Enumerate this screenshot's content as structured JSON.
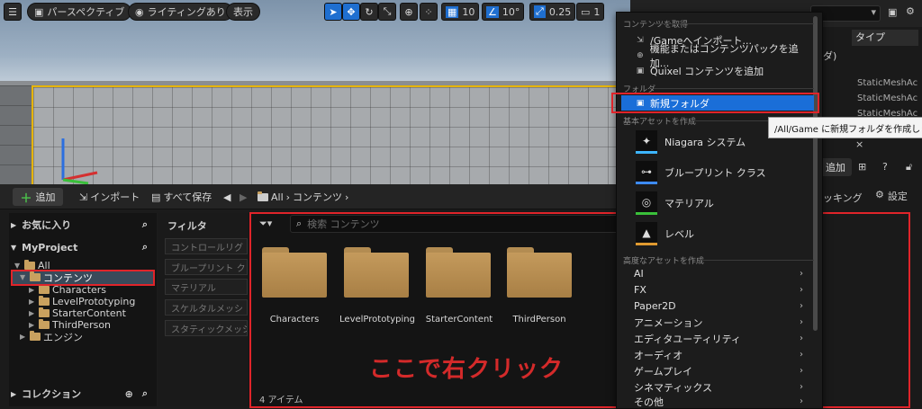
{
  "viewport": {
    "perspective_label": "パースペクティブ",
    "lighting_label": "ライティングあり",
    "show_label": "表示",
    "grid_value": "10",
    "angle_value": "10°",
    "scale_value": "0.25",
    "camera_value": "1"
  },
  "content_browser": {
    "add_label": "追加",
    "import_label": "インポート",
    "save_all_label": "すべて保存",
    "breadcrumb_all": "All",
    "breadcrumb_content": "コンテンツ",
    "favorites_label": "お気に入り",
    "project_label": "MyProject",
    "tree": {
      "all": "All",
      "content": "コンテンツ",
      "characters": "Characters",
      "level_prototyping": "LevelPrototyping",
      "starter_content": "StarterContent",
      "third_person": "ThirdPerson",
      "engine": "エンジン"
    },
    "collections_label": "コレクション",
    "filter_label": "フィルタ",
    "filters": [
      "コントロールリグ",
      "ブループリント ク",
      "マテリアル",
      "スケルタルメッシ",
      "スタティックメッシ"
    ],
    "search_placeholder": "検索 コンテンツ",
    "folders": [
      "Characters",
      "LevelPrototyping",
      "StarterContent",
      "ThirdPerson"
    ],
    "item_count": "4 アイテム",
    "annotation": "ここで右クリック"
  },
  "context_menu": {
    "get_content_header": "コンテンツを取得",
    "import_to_game": "/Gameへインポート...",
    "add_feature_pack": "機能またはコンテンツパックを追加...",
    "add_quixel": "Quixel コンテンツを追加",
    "folder_header": "フォルダ",
    "new_folder": "新規フォルダ",
    "basic_assets_header": "基本アセットを作成",
    "niagara_system": "Niagara システム",
    "blueprint_class": "ブループリント クラス",
    "material": "マテリアル",
    "level": "レベル",
    "advanced_assets_header": "高度なアセットを作成",
    "advanced_items": [
      "AI",
      "FX",
      "Paper2D",
      "アニメーション",
      "エディタユーティリティ",
      "オーディオ",
      "ゲームプレイ",
      "シネマティックス",
      "その他"
    ]
  },
  "tooltip": "/All/Game に新規フォルダを作成します",
  "right_panel": {
    "type_header": "タイプ",
    "folder_cell": "ダ)",
    "row1_type": "StaticMeshAc",
    "row2_type": "StaticMeshAc",
    "row3_type": "StaticMeshAc",
    "add_label": "追加",
    "docking_label": "ッキング",
    "settings_label": "設定"
  },
  "colors": {
    "accent_blue": "#1a6ed8",
    "annotation_red": "#e0242a",
    "folder": "#c49a5c"
  }
}
